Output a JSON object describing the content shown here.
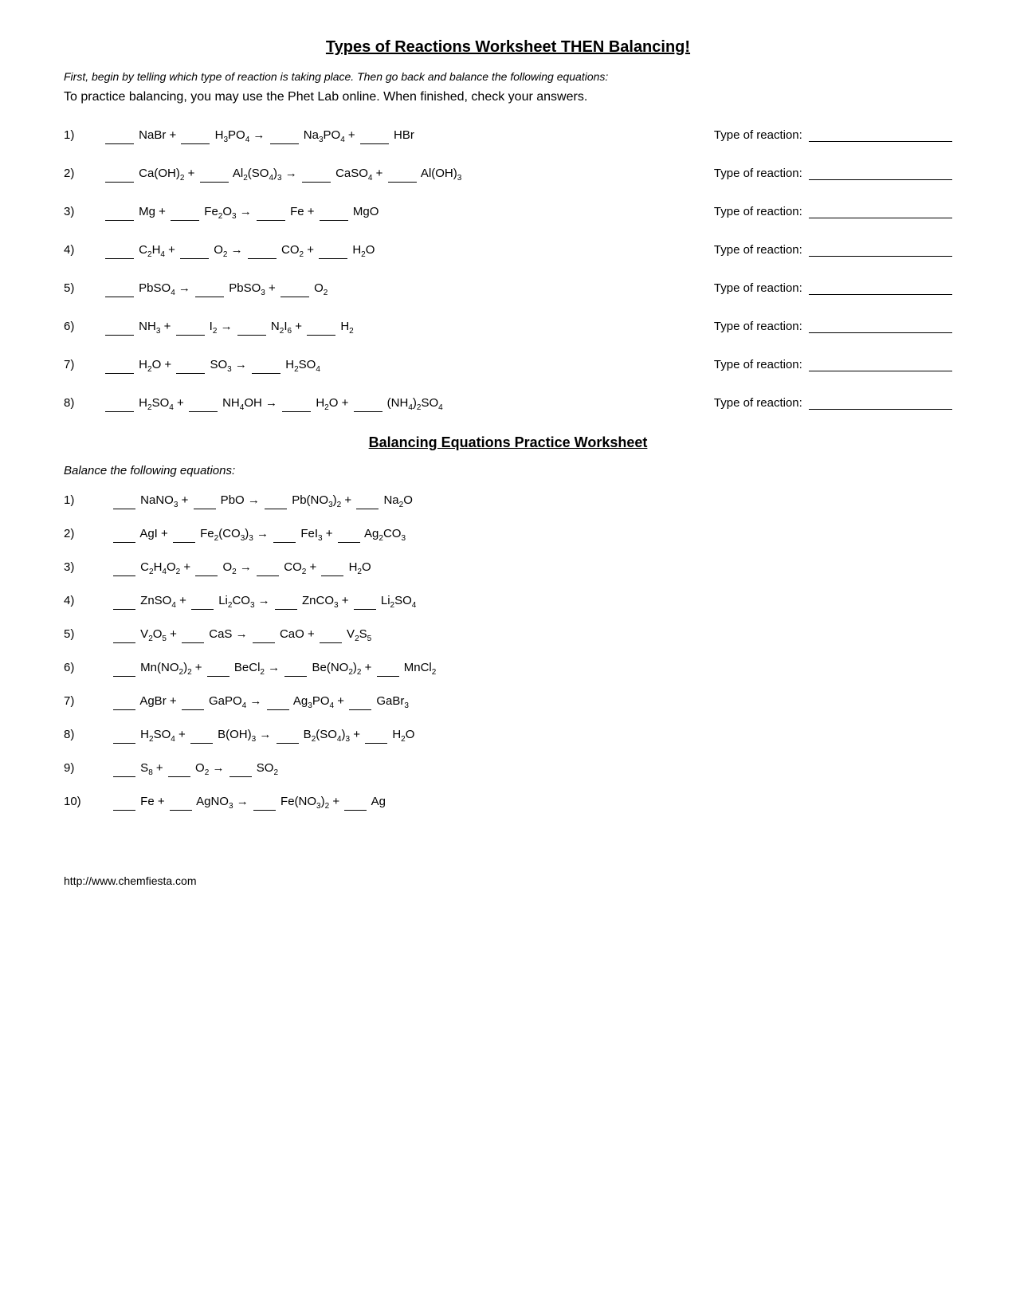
{
  "title": "Types of Reactions Worksheet THEN Balancing!",
  "intro_italic": "First, begin by telling which type of reaction is taking place.  Then go back and balance the following equations:",
  "intro_normal": "To practice balancing, you may use the Phet Lab online.  When finished, check your answers.",
  "type_label": "Type of reaction:",
  "section2_title": "Balancing Equations Practice Worksheet",
  "balance_intro": "Balance the following equations:",
  "footer_url": "http://www.chemfiesta.com"
}
